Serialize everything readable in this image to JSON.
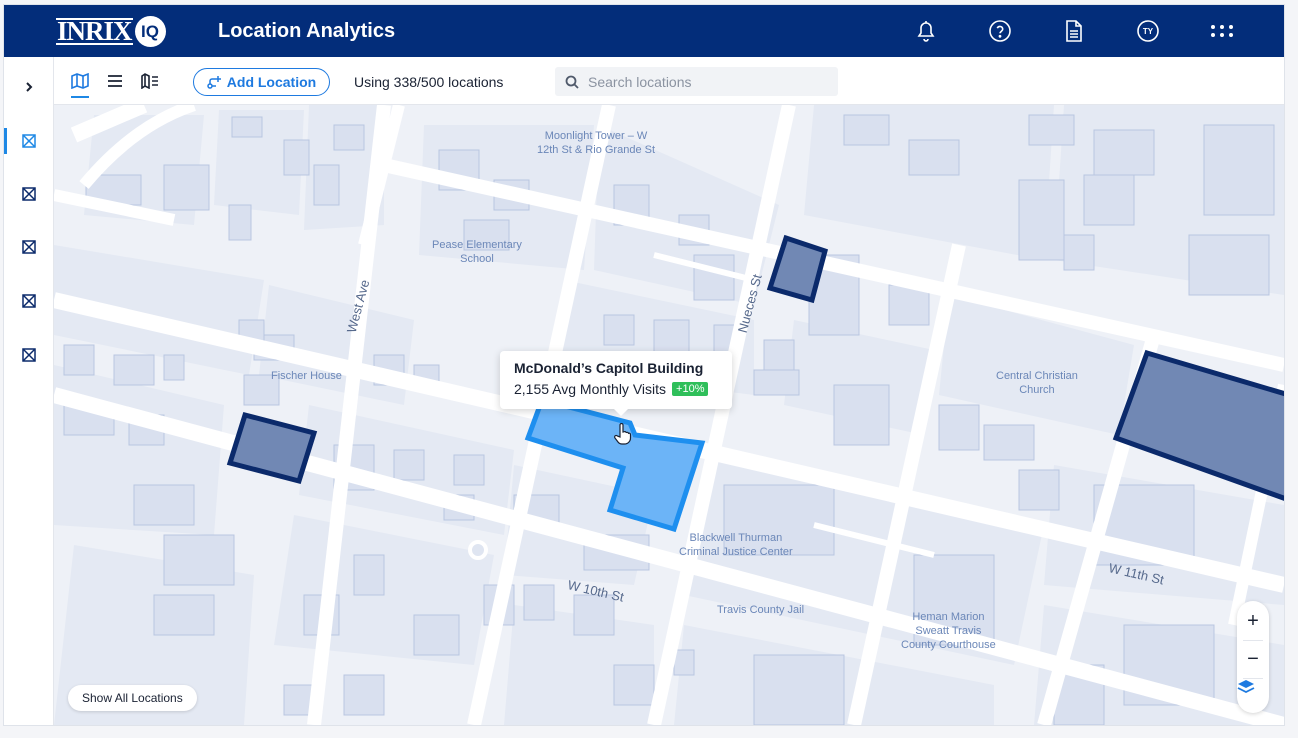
{
  "header": {
    "logo_text": "INRIX",
    "logo_badge": "IQ",
    "title": "Location Analytics",
    "icons": [
      "bell-icon",
      "help-icon",
      "document-icon",
      "user-avatar",
      "apps-grid-icon"
    ],
    "avatar_initials": "TY"
  },
  "leftrail": {
    "expand_icon": "chevron-right-icon",
    "items": [
      "location-1",
      "location-2",
      "location-3",
      "location-4",
      "location-5"
    ],
    "accent": "#1e88e5"
  },
  "toolbar": {
    "views": [
      "map-view-icon",
      "list-view-icon",
      "map-list-view-icon"
    ],
    "add_label": "Add Location",
    "usage_text": "Using 338/500 locations",
    "search_placeholder": "Search locations"
  },
  "map": {
    "labels": {
      "moonlight": "Moonlight Tower – W\n12th St & Rio Grande St",
      "pease": "Pease Elementary\nSchool",
      "fischer": "Fischer House",
      "central": "Central Christian\nChurch",
      "blackwell": "Blackwell Thurman\nCriminal Justice Center",
      "travis_jail": "Travis County Jail",
      "heman": "Heman Marion\nSweatt Travis\nCounty Courthouse"
    },
    "streets": {
      "west_ave": "West Ave",
      "nueces": "Nueces St",
      "w10th": "W 10th St",
      "w11th": "W 11th St"
    },
    "highlight_color": "#1e8fef",
    "location_color": "#0b2a6b"
  },
  "popup": {
    "title": "McDonald’s Capitol Building",
    "visits": "2,155 Avg Monthly Visits",
    "change": "+10%"
  },
  "controls": {
    "show_all": "Show All Locations",
    "zoom_in": "+",
    "zoom_out": "−"
  }
}
